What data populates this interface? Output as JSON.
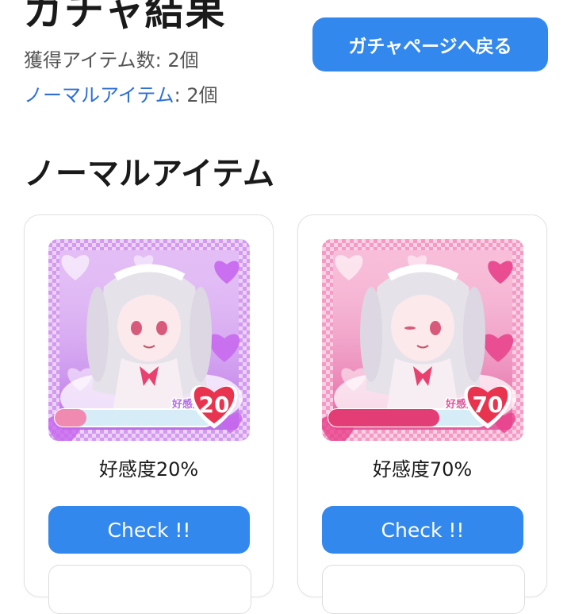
{
  "page": {
    "title": "ガチャ結果",
    "total_label": "獲得アイテム数: 2個",
    "normal_rarity": "ノーマルアイテム",
    "normal_count": ": 2個",
    "back_button": "ガチャページへ戻る"
  },
  "section": {
    "title": "ノーマルアイテム"
  },
  "items": [
    {
      "badge_label": "好感度",
      "affinity": 20,
      "affinity_text": "20",
      "caption": "好感度20%",
      "check_label": "Check !!",
      "theme": "purple",
      "colors": {
        "bg": "#d49af0",
        "accent": "#b56be6",
        "heart": "#c766ee",
        "bar": "#f08ab0"
      }
    },
    {
      "badge_label": "好感度",
      "affinity": 70,
      "affinity_text": "70",
      "caption": "好感度70%",
      "check_label": "Check !!",
      "theme": "pink",
      "colors": {
        "bg": "#f49ac4",
        "accent": "#e0569a",
        "heart": "#e8408a",
        "bar": "#e33d75"
      }
    }
  ],
  "colors": {
    "primary": "#3388ee",
    "link": "#2d6fd6"
  }
}
